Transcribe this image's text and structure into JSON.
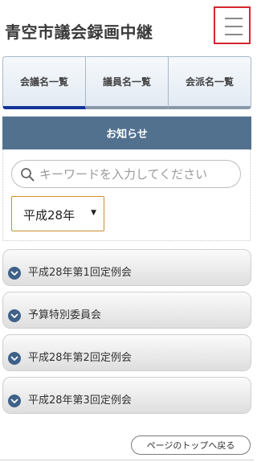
{
  "header": {
    "site_title": "青空市議会録画中継",
    "menu_icon": "hamburger-menu-icon",
    "menu_highlight_color": "#d8262f"
  },
  "tabs": [
    {
      "label": "会議名一覧",
      "active": true
    },
    {
      "label": "議員名一覧",
      "active": false
    },
    {
      "label": "会派名一覧",
      "active": false
    }
  ],
  "notice": {
    "label": "お知らせ",
    "color": "#52718f"
  },
  "search": {
    "icon": "search-icon",
    "placeholder": "キーワードを入力してください",
    "value": ""
  },
  "year_select": {
    "selected": "平成28年"
  },
  "sessions": [
    {
      "label": "平成28年第1回定例会"
    },
    {
      "label": "予算特別委員会"
    },
    {
      "label": "平成28年第2回定例会"
    },
    {
      "label": "平成28年第3回定例会"
    }
  ],
  "back_to_top": {
    "label": "ページのトップへ戻る"
  }
}
